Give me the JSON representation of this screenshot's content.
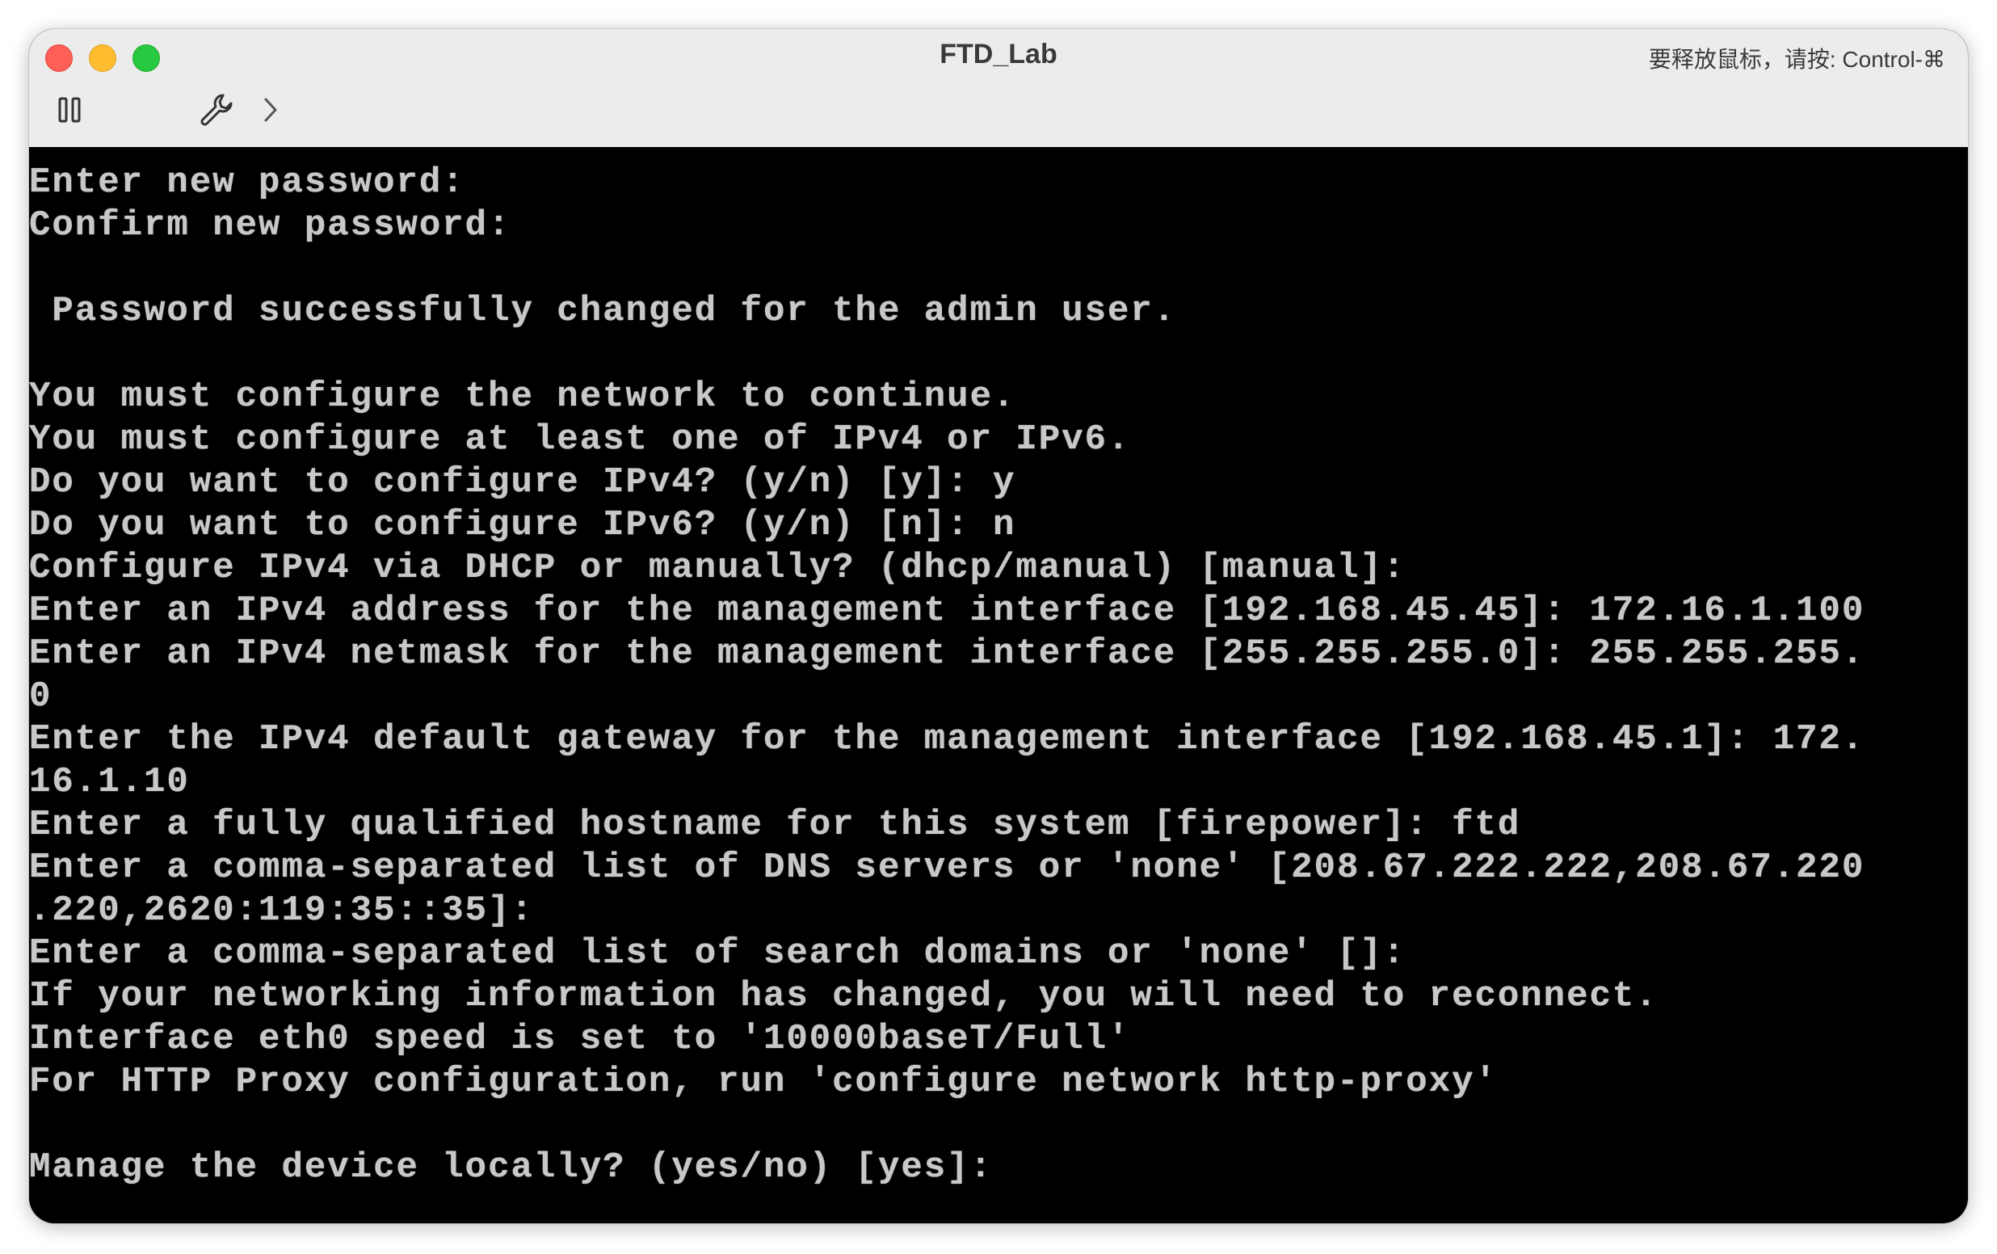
{
  "window": {
    "title": "FTD_Lab",
    "hint": "要释放鼠标，请按: Control-⌘"
  },
  "toolbar": {
    "pause_icon": "pause-icon",
    "settings_icon": "wrench-icon",
    "expand_icon": "chevron-right-icon"
  },
  "terminal": {
    "lines": [
      "Enter new password:",
      "Confirm new password:",
      "",
      " Password successfully changed for the admin user.",
      "",
      "You must configure the network to continue.",
      "You must configure at least one of IPv4 or IPv6.",
      "Do you want to configure IPv4? (y/n) [y]: y",
      "Do you want to configure IPv6? (y/n) [n]: n",
      "Configure IPv4 via DHCP or manually? (dhcp/manual) [manual]:",
      "Enter an IPv4 address for the management interface [192.168.45.45]: 172.16.1.100",
      "Enter an IPv4 netmask for the management interface [255.255.255.0]: 255.255.255.",
      "0",
      "Enter the IPv4 default gateway for the management interface [192.168.45.1]: 172.",
      "16.1.10",
      "Enter a fully qualified hostname for this system [firepower]: ftd",
      "Enter a comma-separated list of DNS servers or 'none' [208.67.222.222,208.67.220",
      ".220,2620:119:35::35]:",
      "Enter a comma-separated list of search domains or 'none' []:",
      "If your networking information has changed, you will need to reconnect.",
      "Interface eth0 speed is set to '10000baseT/Full'",
      "For HTTP Proxy configuration, run 'configure network http-proxy'",
      "",
      "Manage the device locally? (yes/no) [yes]:"
    ]
  }
}
